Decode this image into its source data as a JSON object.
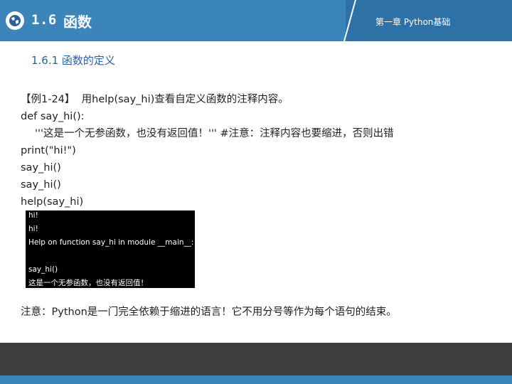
{
  "header": {
    "section_number": "1.6",
    "section_title": "函数",
    "chapter_label": "第一章 Python基础",
    "logo_icon": "globe-icon",
    "colors": {
      "header_bg": "#3b85bb",
      "header_panel": "#2d71a6"
    }
  },
  "subsection": {
    "title": "1.6.1  函数的定义"
  },
  "example": {
    "lines": [
      "【例1-24】  用help(say_hi)查看自定义函数的注释内容。",
      "def say_hi():",
      "'''这是一个无参函数，也没有返回值！''' #注意：注释内容也要缩进，否则出错",
      "print(\"hi!\")",
      "say_hi()",
      "say_hi()",
      "help(say_hi)"
    ]
  },
  "console_output": {
    "lines": [
      "hi!",
      "hi!",
      "Help on function say_hi in module __main__:",
      "say_hi()",
      "这是一个无参函数，也没有返回值！"
    ]
  },
  "note": "注意：Python是一门完全依赖于缩进的语言！它不用分号等作为每个语句的结束。",
  "footer": {
    "colors": {
      "dark": "#3d3d3d",
      "blue": "#3b85bb"
    }
  }
}
